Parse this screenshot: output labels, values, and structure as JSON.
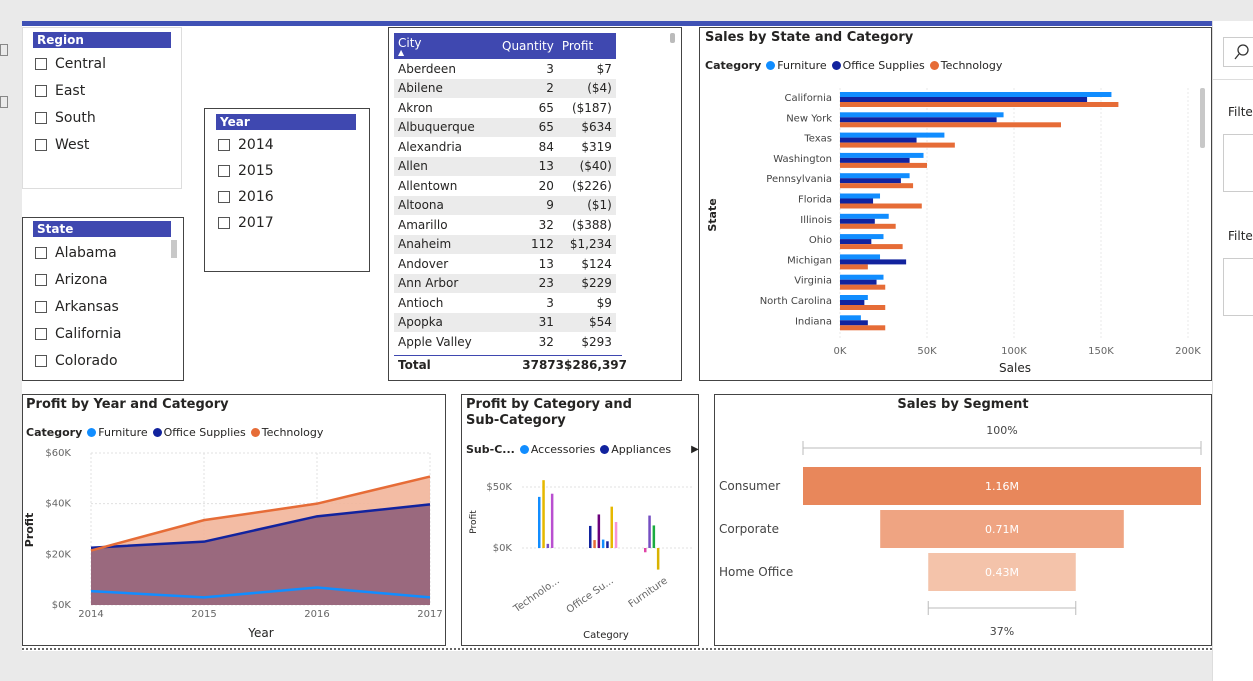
{
  "region_slicer": {
    "title": "Region",
    "items": [
      "Central",
      "East",
      "South",
      "West"
    ]
  },
  "state_slicer": {
    "title": "State",
    "items": [
      "Alabama",
      "Arizona",
      "Arkansas",
      "California",
      "Colorado"
    ]
  },
  "year_slicer": {
    "title": "Year",
    "items": [
      "2014",
      "2015",
      "2016",
      "2017"
    ]
  },
  "city_table": {
    "headers": [
      "City",
      "Quantity",
      "Profit"
    ],
    "rows": [
      [
        "Aberdeen",
        "3",
        "$7"
      ],
      [
        "Abilene",
        "2",
        "($4)"
      ],
      [
        "Akron",
        "65",
        "($187)"
      ],
      [
        "Albuquerque",
        "65",
        "$634"
      ],
      [
        "Alexandria",
        "84",
        "$319"
      ],
      [
        "Allen",
        "13",
        "($40)"
      ],
      [
        "Allentown",
        "20",
        "($226)"
      ],
      [
        "Altoona",
        "9",
        "($1)"
      ],
      [
        "Amarillo",
        "32",
        "($388)"
      ],
      [
        "Anaheim",
        "112",
        "$1,234"
      ],
      [
        "Andover",
        "13",
        "$124"
      ],
      [
        "Ann Arbor",
        "23",
        "$229"
      ],
      [
        "Antioch",
        "3",
        "$9"
      ],
      [
        "Apopka",
        "31",
        "$54"
      ],
      [
        "Apple Valley",
        "32",
        "$293"
      ]
    ],
    "total": [
      "Total",
      "37873",
      "$286,397"
    ]
  },
  "colors": {
    "furniture": "#118dff",
    "office": "#12239e",
    "technology": "#e66c37",
    "slicer": "#3f48b0"
  },
  "right_pane": {
    "search_icon": "search-icon",
    "filters_label_1": "Filte",
    "filters_label_2": "Filte"
  },
  "chart_data": [
    {
      "type": "bar",
      "title": "Sales by State and Category",
      "legend_title": "Category",
      "xlabel": "Sales",
      "ylabel": "State",
      "xlim": [
        0,
        200000
      ],
      "xticks": [
        "0K",
        "50K",
        "100K",
        "150K",
        "200K"
      ],
      "categories": [
        "California",
        "New York",
        "Texas",
        "Washington",
        "Pennsylvania",
        "Florida",
        "Illinois",
        "Ohio",
        "Michigan",
        "Virginia",
        "North Carolina",
        "Indiana"
      ],
      "series": [
        {
          "name": "Furniture",
          "values": [
            156000,
            94000,
            60000,
            48000,
            40000,
            23000,
            28000,
            25000,
            23000,
            25000,
            16000,
            12000
          ]
        },
        {
          "name": "Office Supplies",
          "values": [
            142000,
            90000,
            44000,
            40000,
            35000,
            19000,
            20000,
            18000,
            38000,
            21000,
            14000,
            16000
          ]
        },
        {
          "name": "Technology",
          "values": [
            160000,
            127000,
            66000,
            50000,
            42000,
            47000,
            32000,
            36000,
            16000,
            26000,
            26000,
            26000
          ]
        }
      ]
    },
    {
      "type": "area",
      "title": "Profit by Year and Category",
      "legend_title": "Category",
      "xlabel": "Year",
      "ylabel": "Profit",
      "x": [
        "2014",
        "2015",
        "2016",
        "2017"
      ],
      "ylim": [
        0,
        60000
      ],
      "yticks": [
        "$0K",
        "$20K",
        "$40K",
        "$60K"
      ],
      "series": [
        {
          "name": "Furniture",
          "values": [
            5500,
            3000,
            6900,
            3000
          ]
        },
        {
          "name": "Office Supplies",
          "values": [
            22600,
            25000,
            35000,
            39700
          ]
        },
        {
          "name": "Technology",
          "values": [
            21500,
            33500,
            40000,
            50700
          ]
        }
      ]
    },
    {
      "type": "bar",
      "title": "Profit by Category and Sub-Category",
      "legend_title": "Sub-C...",
      "legend_items": [
        "Accessories",
        "Appliances"
      ],
      "xlabel": "Category",
      "ylabel": "Profit",
      "categories": [
        "Technolo...",
        "Office Su...",
        "Furniture"
      ],
      "yticks": [
        "$0K",
        "$50K"
      ],
      "ylim": [
        -15000,
        60000
      ],
      "bars": [
        {
          "cat": 0,
          "value": 41900,
          "color": "#118dff"
        },
        {
          "cat": 0,
          "value": 55600,
          "color": "#e6b800"
        },
        {
          "cat": 0,
          "value": 3400,
          "color": "#744ec2"
        },
        {
          "cat": 0,
          "value": 44500,
          "color": "#b94fd0"
        },
        {
          "cat": 1,
          "value": 18100,
          "color": "#12239e"
        },
        {
          "cat": 1,
          "value": 6500,
          "color": "#e66c37"
        },
        {
          "cat": 1,
          "value": 27500,
          "color": "#6b007b"
        },
        {
          "cat": 1,
          "value": 6900,
          "color": "#118dff"
        },
        {
          "cat": 1,
          "value": 5500,
          "color": "#12239e"
        },
        {
          "cat": 1,
          "value": 33900,
          "color": "#e6b800"
        },
        {
          "cat": 1,
          "value": 21300,
          "color": "#f694d4"
        },
        {
          "cat": 2,
          "value": -3500,
          "color": "#e044a7"
        },
        {
          "cat": 2,
          "value": 26600,
          "color": "#744ec2"
        },
        {
          "cat": 2,
          "value": 18500,
          "color": "#1aab40"
        },
        {
          "cat": 2,
          "value": -17700,
          "color": "#d9b300"
        }
      ]
    },
    {
      "type": "funnel",
      "title": "Sales by Segment",
      "top_label": "100%",
      "bottom_label": "37%",
      "categories": [
        "Consumer",
        "Corporate",
        "Home Office"
      ],
      "values": [
        1.16,
        0.71,
        0.43
      ],
      "value_labels": [
        "1.16M",
        "0.71M",
        "0.43M"
      ],
      "colors": [
        "#e8875b",
        "#efa482",
        "#f4c3aa"
      ]
    }
  ]
}
